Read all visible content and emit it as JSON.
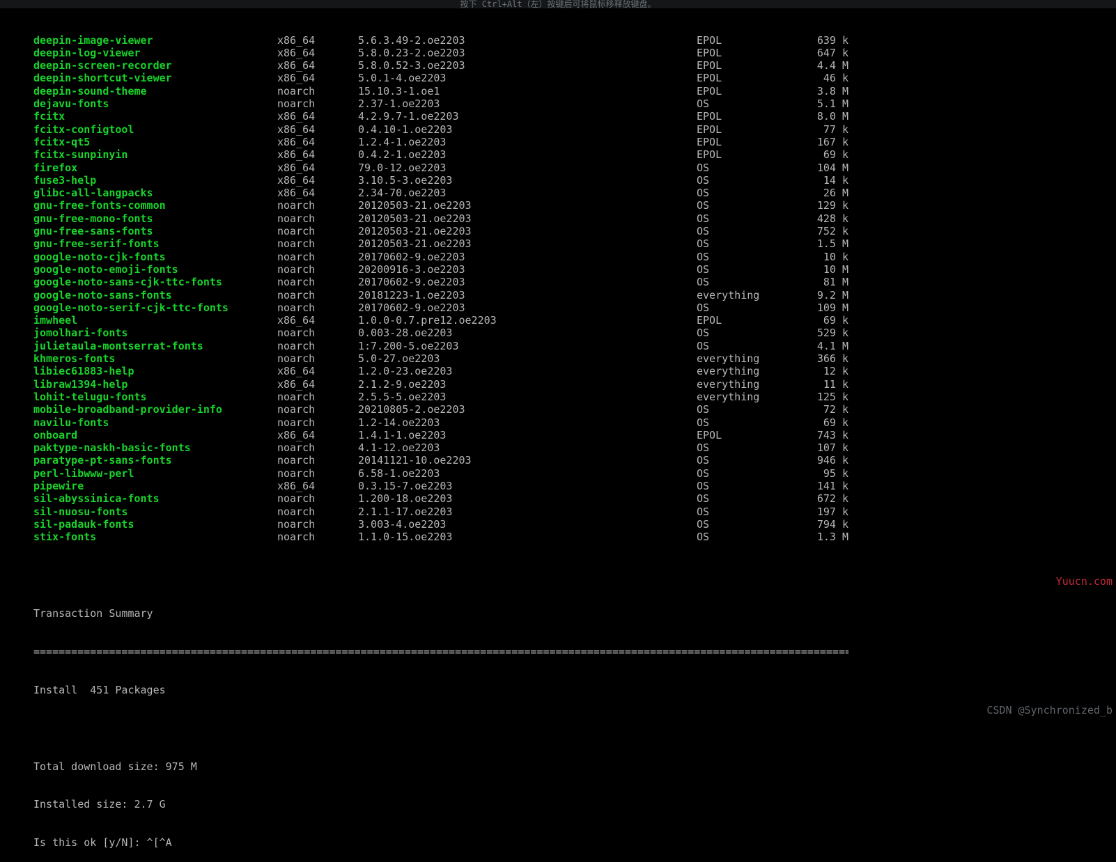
{
  "topbar_hint": "按下 Ctrl+Alt（左）按键后可将鼠标移释放键盘。",
  "rows": [
    {
      "name": "deepin-image-viewer",
      "arch": "x86_64",
      "ver": "5.6.3.49-2.oe2203",
      "repo": "EPOL",
      "size": "639 k"
    },
    {
      "name": "deepin-log-viewer",
      "arch": "x86_64",
      "ver": "5.8.0.23-2.oe2203",
      "repo": "EPOL",
      "size": "647 k"
    },
    {
      "name": "deepin-screen-recorder",
      "arch": "x86_64",
      "ver": "5.8.0.52-3.oe2203",
      "repo": "EPOL",
      "size": "4.4 M"
    },
    {
      "name": "deepin-shortcut-viewer",
      "arch": "x86_64",
      "ver": "5.0.1-4.oe2203",
      "repo": "EPOL",
      "size": "46 k"
    },
    {
      "name": "deepin-sound-theme",
      "arch": "noarch",
      "ver": "15.10.3-1.oe1",
      "repo": "EPOL",
      "size": "3.8 M"
    },
    {
      "name": "dejavu-fonts",
      "arch": "noarch",
      "ver": "2.37-1.oe2203",
      "repo": "OS",
      "size": "5.1 M"
    },
    {
      "name": "fcitx",
      "arch": "x86_64",
      "ver": "4.2.9.7-1.oe2203",
      "repo": "EPOL",
      "size": "8.0 M"
    },
    {
      "name": "fcitx-configtool",
      "arch": "x86_64",
      "ver": "0.4.10-1.oe2203",
      "repo": "EPOL",
      "size": "77 k"
    },
    {
      "name": "fcitx-qt5",
      "arch": "x86_64",
      "ver": "1.2.4-1.oe2203",
      "repo": "EPOL",
      "size": "167 k"
    },
    {
      "name": "fcitx-sunpinyin",
      "arch": "x86_64",
      "ver": "0.4.2-1.oe2203",
      "repo": "EPOL",
      "size": "69 k"
    },
    {
      "name": "firefox",
      "arch": "x86_64",
      "ver": "79.0-12.oe2203",
      "repo": "OS",
      "size": "104 M"
    },
    {
      "name": "fuse3-help",
      "arch": "x86_64",
      "ver": "3.10.5-3.oe2203",
      "repo": "OS",
      "size": "14 k"
    },
    {
      "name": "glibc-all-langpacks",
      "arch": "x86_64",
      "ver": "2.34-70.oe2203",
      "repo": "OS",
      "size": "26 M"
    },
    {
      "name": "gnu-free-fonts-common",
      "arch": "noarch",
      "ver": "20120503-21.oe2203",
      "repo": "OS",
      "size": "129 k"
    },
    {
      "name": "gnu-free-mono-fonts",
      "arch": "noarch",
      "ver": "20120503-21.oe2203",
      "repo": "OS",
      "size": "428 k"
    },
    {
      "name": "gnu-free-sans-fonts",
      "arch": "noarch",
      "ver": "20120503-21.oe2203",
      "repo": "OS",
      "size": "752 k"
    },
    {
      "name": "gnu-free-serif-fonts",
      "arch": "noarch",
      "ver": "20120503-21.oe2203",
      "repo": "OS",
      "size": "1.5 M"
    },
    {
      "name": "google-noto-cjk-fonts",
      "arch": "noarch",
      "ver": "20170602-9.oe2203",
      "repo": "OS",
      "size": "10 k"
    },
    {
      "name": "google-noto-emoji-fonts",
      "arch": "noarch",
      "ver": "20200916-3.oe2203",
      "repo": "OS",
      "size": "10 M"
    },
    {
      "name": "google-noto-sans-cjk-ttc-fonts",
      "arch": "noarch",
      "ver": "20170602-9.oe2203",
      "repo": "OS",
      "size": "81 M"
    },
    {
      "name": "google-noto-sans-fonts",
      "arch": "noarch",
      "ver": "20181223-1.oe2203",
      "repo": "everything",
      "size": "9.2 M"
    },
    {
      "name": "google-noto-serif-cjk-ttc-fonts",
      "arch": "noarch",
      "ver": "20170602-9.oe2203",
      "repo": "OS",
      "size": "109 M"
    },
    {
      "name": "imwheel",
      "arch": "x86_64",
      "ver": "1.0.0-0.7.pre12.oe2203",
      "repo": "EPOL",
      "size": "69 k"
    },
    {
      "name": "jomolhari-fonts",
      "arch": "noarch",
      "ver": "0.003-28.oe2203",
      "repo": "OS",
      "size": "529 k"
    },
    {
      "name": "julietaula-montserrat-fonts",
      "arch": "noarch",
      "ver": "1:7.200-5.oe2203",
      "repo": "OS",
      "size": "4.1 M"
    },
    {
      "name": "khmeros-fonts",
      "arch": "noarch",
      "ver": "5.0-27.oe2203",
      "repo": "everything",
      "size": "366 k"
    },
    {
      "name": "libiec61883-help",
      "arch": "x86_64",
      "ver": "1.2.0-23.oe2203",
      "repo": "everything",
      "size": "12 k"
    },
    {
      "name": "libraw1394-help",
      "arch": "x86_64",
      "ver": "2.1.2-9.oe2203",
      "repo": "everything",
      "size": "11 k"
    },
    {
      "name": "lohit-telugu-fonts",
      "arch": "noarch",
      "ver": "2.5.5-5.oe2203",
      "repo": "everything",
      "size": "125 k"
    },
    {
      "name": "mobile-broadband-provider-info",
      "arch": "noarch",
      "ver": "20210805-2.oe2203",
      "repo": "OS",
      "size": "72 k"
    },
    {
      "name": "navilu-fonts",
      "arch": "noarch",
      "ver": "1.2-14.oe2203",
      "repo": "OS",
      "size": "69 k"
    },
    {
      "name": "onboard",
      "arch": "x86_64",
      "ver": "1.4.1-1.oe2203",
      "repo": "EPOL",
      "size": "743 k"
    },
    {
      "name": "paktype-naskh-basic-fonts",
      "arch": "noarch",
      "ver": "4.1-12.oe2203",
      "repo": "OS",
      "size": "107 k"
    },
    {
      "name": "paratype-pt-sans-fonts",
      "arch": "noarch",
      "ver": "20141121-10.oe2203",
      "repo": "OS",
      "size": "946 k"
    },
    {
      "name": "perl-libwww-perl",
      "arch": "noarch",
      "ver": "6.58-1.oe2203",
      "repo": "OS",
      "size": "95 k"
    },
    {
      "name": "pipewire",
      "arch": "x86_64",
      "ver": "0.3.15-7.oe2203",
      "repo": "OS",
      "size": "141 k"
    },
    {
      "name": "sil-abyssinica-fonts",
      "arch": "noarch",
      "ver": "1.200-18.oe2203",
      "repo": "OS",
      "size": "672 k"
    },
    {
      "name": "sil-nuosu-fonts",
      "arch": "noarch",
      "ver": "2.1.1-17.oe2203",
      "repo": "OS",
      "size": "197 k"
    },
    {
      "name": "sil-padauk-fonts",
      "arch": "noarch",
      "ver": "3.003-4.oe2203",
      "repo": "OS",
      "size": "794 k"
    },
    {
      "name": "stix-fonts",
      "arch": "noarch",
      "ver": "1.1.0-15.oe2203",
      "repo": "OS",
      "size": "1.3 M"
    }
  ],
  "summary": {
    "title": "Transaction Summary",
    "install_line": "Install  451 Packages",
    "download_size": "Total download size: 975 M",
    "installed_size": "Installed size: 2.7 G",
    "prompt": "Is this ok [y/N]: ^[^A"
  },
  "watermark1": "Yuucn.com",
  "watermark2": "CSDN @Synchronized_b"
}
